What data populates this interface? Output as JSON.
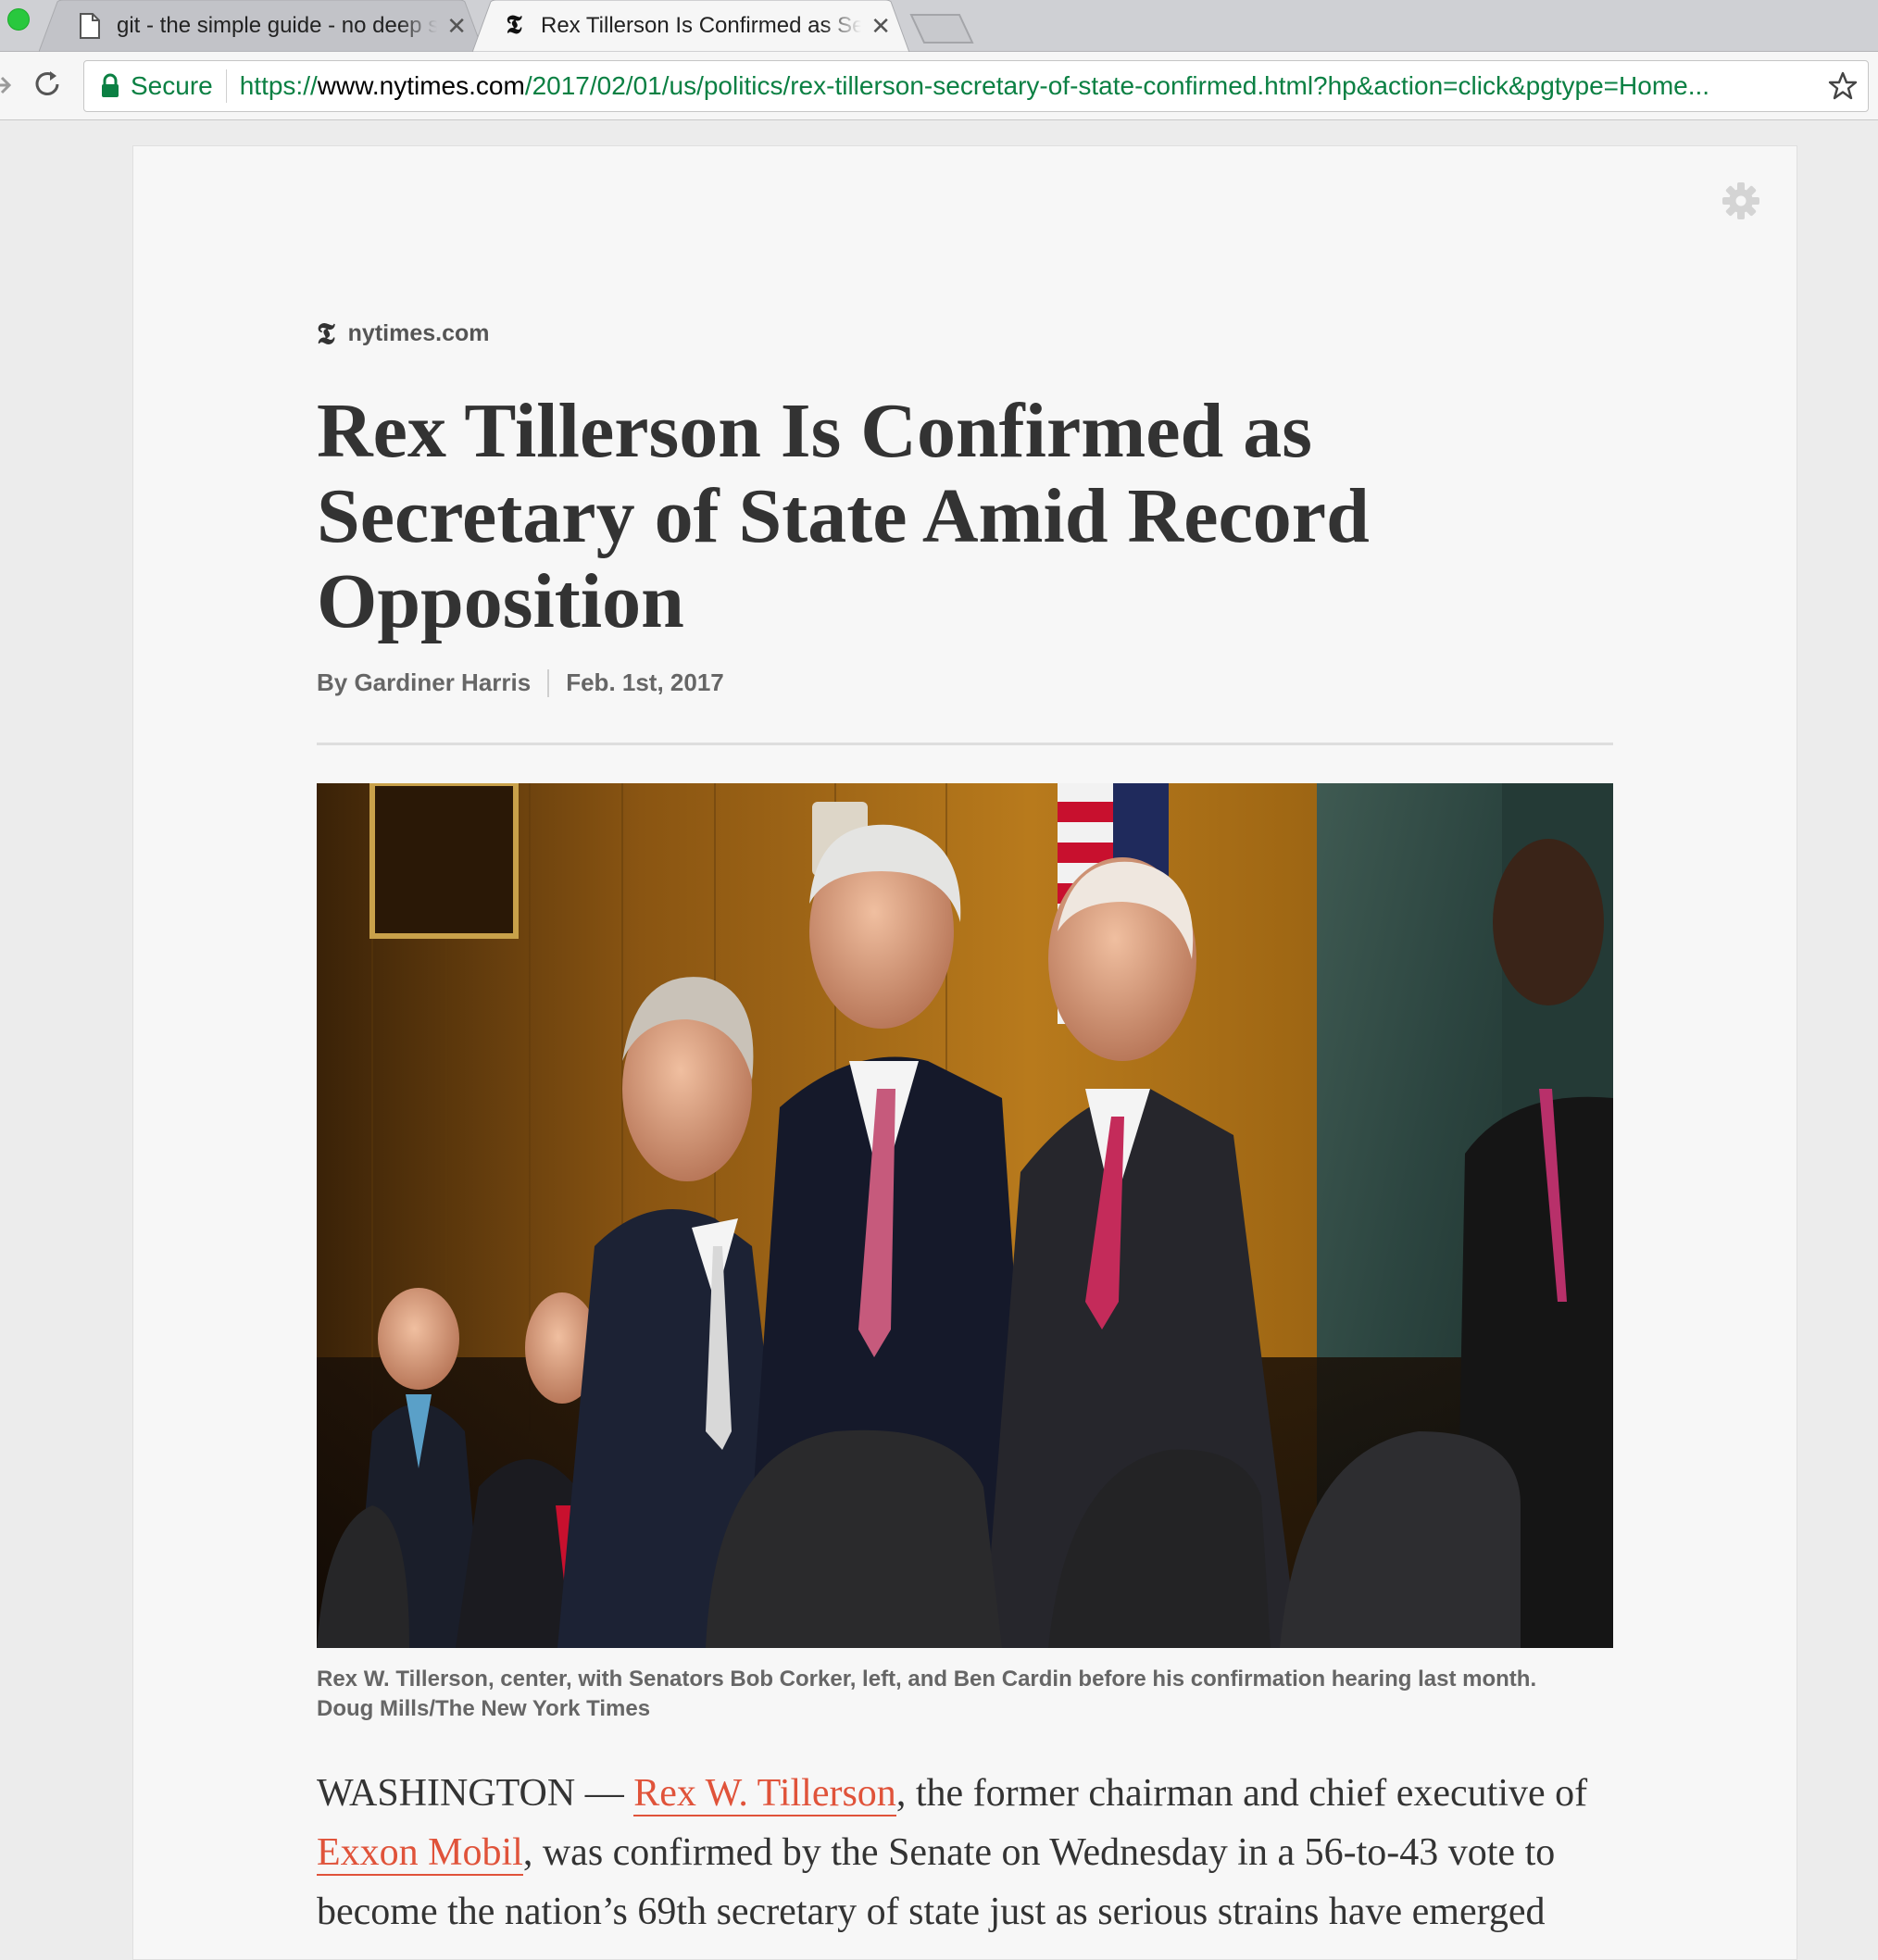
{
  "browser": {
    "tabs": [
      {
        "title": "git - the simple guide - no deep shit!",
        "icon": "document-icon",
        "active": false
      },
      {
        "title": "Rex Tillerson Is Confirmed as Secretary of State",
        "icon": "nyt-logo-icon",
        "active": true
      }
    ],
    "address_bar": {
      "secure_label": "Secure",
      "scheme": "https://",
      "host": "www.nytimes.com",
      "path": "/2017/02/01/us/politics/rex-tillerson-secretary-of-state-confirmed.html?hp&action=click&pgtype=Home..."
    }
  },
  "article": {
    "source": "nytimes.com",
    "source_logo": "𝕿",
    "headline": "Rex Tillerson Is Confirmed as Secretary of State Amid Record Opposition",
    "byline": "By Gardiner Harris",
    "date": "Feb. 1st, 2017",
    "caption_line1": "Rex W. Tillerson, center, with Senators Bob Corker, left, and Ben Cardin before his confirmation hearing last month.",
    "caption_line2": "Doug Mills/The New York Times",
    "body": {
      "lead_in": "WASHINGTON — ",
      "link1": "Rex W. Tillerson",
      "text1": ", the former chairman and chief executive of ",
      "link2": "Exxon Mobil",
      "text2": ", was confirmed by the Senate on Wednesday in a 56-to-43 vote to become the nation’s 69th secretary of state just as serious strains have emerged"
    }
  },
  "colors": {
    "link": "#e0533a",
    "secure_green": "#0b8043",
    "headline": "#333333"
  }
}
